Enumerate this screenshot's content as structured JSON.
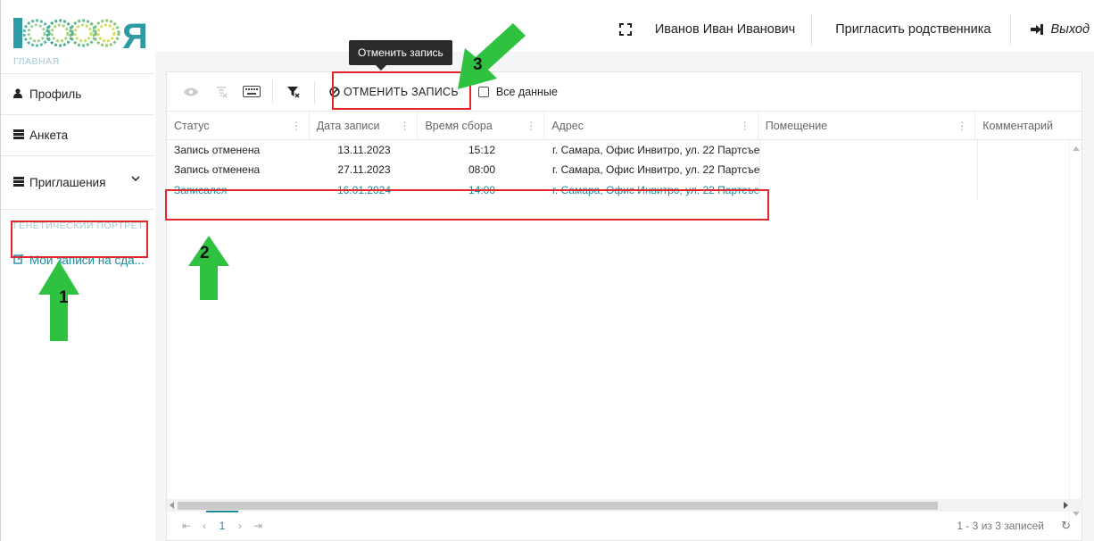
{
  "header": {
    "user_name": "Иванов Иван Иванович",
    "invite_label": "Пригласить родственника",
    "logout_label": "Выход",
    "logo_text": "100000 Я"
  },
  "sidebar": {
    "section_main": "ГЛАВНАЯ",
    "items": [
      {
        "label": "Профиль",
        "icon": "user-icon"
      },
      {
        "label": "Анкета",
        "icon": "list-icon"
      },
      {
        "label": "Приглашения",
        "icon": "list-icon"
      }
    ],
    "section_genetic": "ГЕНЕТИЧЕСКИЙ ПОРТРЕТ",
    "active_item": "Мои записи на сда..."
  },
  "toolbar": {
    "cancel_label": "ОТМЕНИТЬ ЗАПИСЬ",
    "all_data_label": "Все данные",
    "tooltip": "Отменить запись"
  },
  "grid": {
    "columns": [
      "Статус",
      "Дата записи",
      "Время сбора",
      "Адрес",
      "Помещение",
      "Комментарий"
    ],
    "rows": [
      {
        "status": "Запись отменена",
        "date": "13.11.2023",
        "time": "15:12",
        "address": "г. Самара, Офис Инвитро, ул. 22 Партсъез"
      },
      {
        "status": "Запись отменена",
        "date": "27.11.2023",
        "time": "08:00",
        "address": "г. Самара, Офис Инвитро, ул. 22 Партсъез"
      },
      {
        "status": "Записался",
        "date": "16.01.2024",
        "time": "14:00",
        "address": "г. Самара, Офис Инвитро, ул. 22 Партсъез"
      }
    ]
  },
  "pager": {
    "current_page": "1",
    "info": "1 - 3 из 3 записей"
  },
  "annotations": {
    "n1": "1",
    "n2": "2",
    "n3": "3"
  },
  "colors": {
    "accent": "#1a8a9e",
    "highlight": "#e3262b",
    "arrow": "#2fc241"
  }
}
